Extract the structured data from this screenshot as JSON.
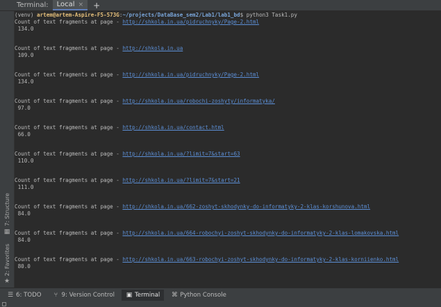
{
  "header": {
    "title": "Terminal:",
    "tab_label": "Local",
    "tab_close": "×",
    "add_tab": "+"
  },
  "left_tabs": {
    "structure": "7: Structure",
    "favorites": "2: Favorites"
  },
  "terminal": {
    "prompt": {
      "venv": "(venv) ",
      "user": "artem@artem-Aspire-F5-573G",
      "sep": ":",
      "path": "~/projects/DataBase_sem2/Lab1/lab1_bd",
      "command": "$ python3 Task1.py"
    },
    "label": "Count of text fragments at page - ",
    "entries": [
      {
        "url": "http://shkola.in.ua/pidruchnyky/Page-2.html",
        "value": " 134.0"
      },
      {
        "url": "http://shkola.in.ua",
        "value": " 109.0"
      },
      {
        "url": "http://shkola.in.ua/pidruchnyky/Page-2.html",
        "value": " 134.0"
      },
      {
        "url": "http://shkola.in.ua/robochi-zoshyty/informatyka/",
        "value": " 97.0"
      },
      {
        "url": "http://shkola.in.ua/contact.html",
        "value": " 66.0"
      },
      {
        "url": "http://shkola.in.ua/?limit=7&start=63",
        "value": " 110.0"
      },
      {
        "url": "http://shkola.in.ua/?limit=7&start=21",
        "value": " 111.0"
      },
      {
        "url": "http://shkola.in.ua/662-zoshyt-skhodynky-do-informatyky-2-klas-korshunova.html",
        "value": " 84.0"
      },
      {
        "url": "http://shkola.in.ua/664-robochyi-zoshyt-skhodynky-do-informatyky-2-klas-lomakovska.html",
        "value": " 84.0"
      },
      {
        "url": "http://shkola.in.ua/663-robochyi-zoshyt-skhodynky-do-informatyky-2-klas-korniienko.html",
        "value": " 80.0"
      }
    ]
  },
  "bottom_tabs": [
    {
      "icon": "todo-icon",
      "label": "6: TODO"
    },
    {
      "icon": "version-control-icon",
      "label": "9: Version Control"
    },
    {
      "icon": "terminal-icon",
      "label": "Terminal"
    },
    {
      "icon": "python-console-icon",
      "label": "Python Console"
    }
  ]
}
